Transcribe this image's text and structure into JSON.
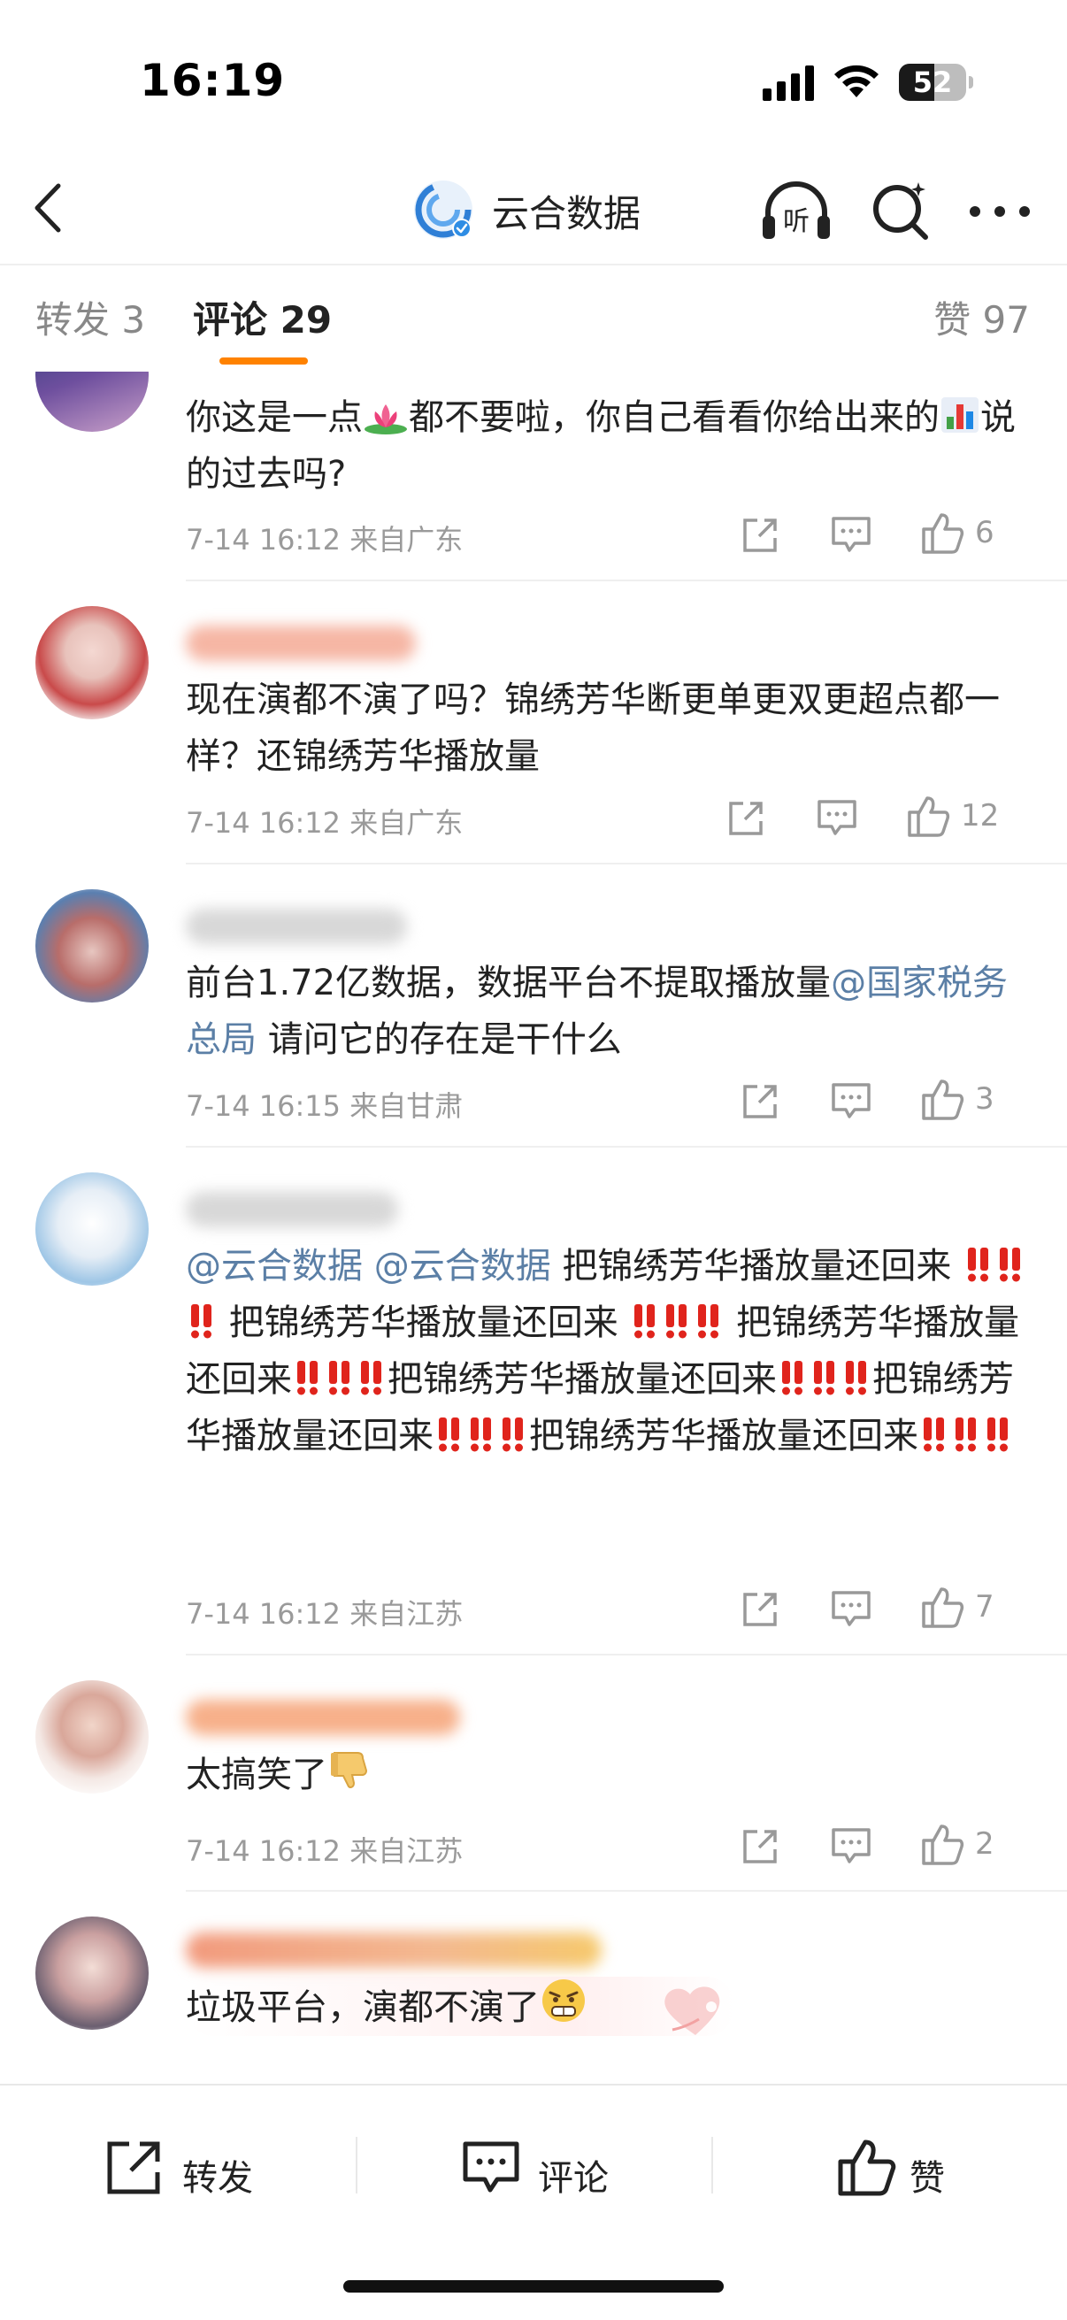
{
  "status_bar": {
    "time": "16:19",
    "battery": "52",
    "battery_level": 0.52
  },
  "nav": {
    "title": "云合数据",
    "listen_label": "听"
  },
  "tabs": [
    {
      "label": "转发 3"
    },
    {
      "label": "评论 29"
    },
    {
      "label": "赞 97"
    }
  ],
  "comments": [
    {
      "text_a": "你这是一点",
      "text_b": "都不要啦，你自己看看你给出来的",
      "text_c": "说的过去吗?",
      "meta": "7-14 16:12 来自广东",
      "likes": "6"
    },
    {
      "text": "现在演都不演了吗？锦绣芳华断更单更双更超点都一样？还锦绣芳华播放量",
      "meta": "7-14 16:12 来自广东",
      "likes": "12"
    },
    {
      "text_a": "前台1.72亿数据，数据平台不提取播放量",
      "mention": "@国家税务总局",
      "text_b": " 请问它的存在是干什么",
      "meta": "7-14 16:15 来自甘肃",
      "likes": "3"
    },
    {
      "mention_1": "@云合数据",
      "mention_2": "@云合数据",
      "phrase": "把锦绣芳华播放量还回来",
      "meta": "7-14 16:12 来自江苏",
      "likes": "7"
    },
    {
      "text": "太搞笑了",
      "meta": "7-14 16:12 来自江苏",
      "likes": "2"
    },
    {
      "text": "垃圾平台，演都不演了"
    }
  ],
  "bottom_bar": {
    "repost": "转发",
    "comment": "评论",
    "like": "赞"
  },
  "colors": {
    "accent": "#ff8200",
    "mention": "#5b7fa6",
    "meta": "#9a9a9a",
    "danger": "#e0241c"
  }
}
